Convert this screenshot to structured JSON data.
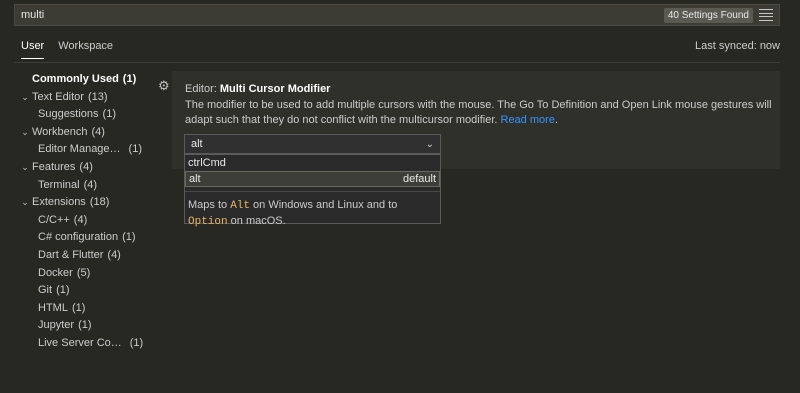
{
  "search": {
    "value": "multi",
    "results_badge": "40 Settings Found",
    "filter_icon": "filter-icon"
  },
  "tabs": {
    "user": "User",
    "workspace": "Workspace",
    "last_synced": "Last synced: now"
  },
  "sidebar": {
    "items": [
      {
        "label": "Commonly Used",
        "count": "(1)"
      },
      {
        "label": "Text Editor",
        "count": "(13)"
      },
      {
        "label": "Suggestions",
        "count": "(1)"
      },
      {
        "label": "Workbench",
        "count": "(4)"
      },
      {
        "label": "Editor Manage…",
        "count": "(1)"
      },
      {
        "label": "Features",
        "count": "(4)"
      },
      {
        "label": "Terminal",
        "count": "(4)"
      },
      {
        "label": "Extensions",
        "count": "(18)"
      },
      {
        "label": "C/C++",
        "count": "(4)"
      },
      {
        "label": "C# configuration",
        "count": "(1)"
      },
      {
        "label": "Dart & Flutter",
        "count": "(4)"
      },
      {
        "label": "Docker",
        "count": "(5)"
      },
      {
        "label": "Git",
        "count": "(1)"
      },
      {
        "label": "HTML",
        "count": "(1)"
      },
      {
        "label": "Jupyter",
        "count": "(1)"
      },
      {
        "label": "Live Server Co…",
        "count": "(1)"
      }
    ]
  },
  "setting": {
    "category": "Editor: ",
    "name": "Multi Cursor Modifier",
    "description": "The modifier to be used to add multiple cursors with the mouse. The Go To Definition and Open Link mouse gestures will adapt such that they do not conflict with the multicursor modifier.",
    "read_more": "Read more",
    "period": ".",
    "selected_value": "alt",
    "options": [
      {
        "label": "ctrlCmd",
        "tag": ""
      },
      {
        "label": "alt",
        "tag": "default"
      }
    ],
    "option_desc": {
      "p1": "Maps to ",
      "alt": "Alt",
      "p2": " on Windows and Linux and to ",
      "option": "Option",
      "p3": " on macOS."
    }
  }
}
